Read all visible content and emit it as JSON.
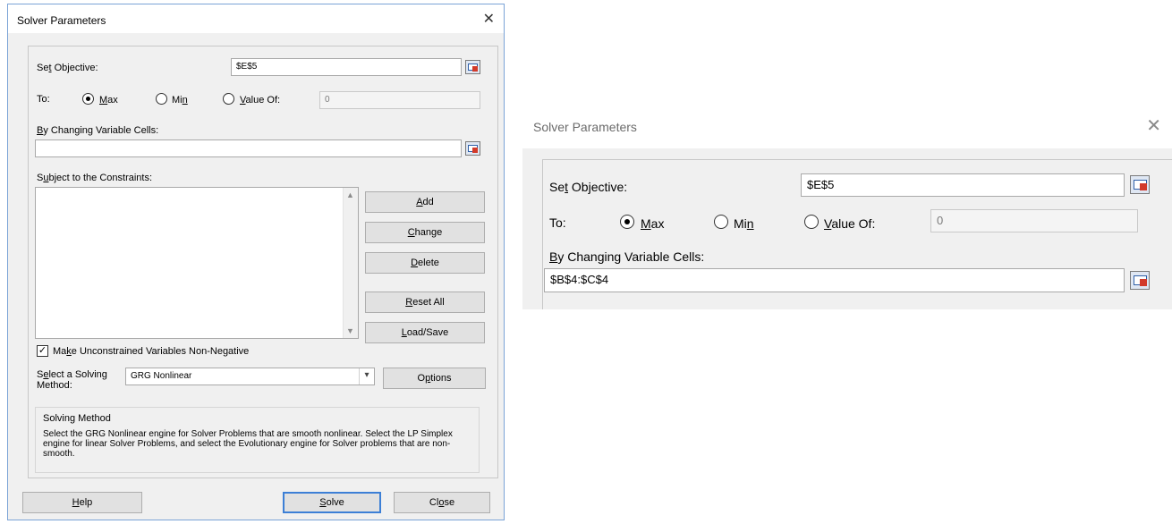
{
  "dialog1": {
    "title": "Solver Parameters",
    "close_icon": "✕",
    "set_objective": {
      "label": "Set Objective:",
      "value": "$E$5"
    },
    "to": {
      "label": "To:",
      "max": "Max",
      "min": "Min",
      "value_of": "Value Of:",
      "value_of_value": "0",
      "selected": "max"
    },
    "changing_cells": {
      "label": "By Changing Variable Cells:",
      "value": ""
    },
    "constraints": {
      "label": "Subject to the Constraints:",
      "items": []
    },
    "buttons": {
      "add": "Add",
      "change": "Change",
      "delete": "Delete",
      "reset_all": "Reset All",
      "load_save": "Load/Save",
      "options": "Options",
      "help": "Help",
      "solve": "Solve",
      "close": "Close"
    },
    "non_negative": {
      "label": "Make Unconstrained Variables Non-Negative",
      "checked": true
    },
    "method": {
      "label": "Select a Solving Method:",
      "selected": "GRG Nonlinear"
    },
    "solving_method": {
      "title": "Solving Method",
      "text": "Select the GRG Nonlinear engine for Solver Problems that are smooth nonlinear. Select the LP Simplex engine for linear Solver Problems, and select the Evolutionary engine for Solver problems that are non-smooth."
    }
  },
  "dialog2": {
    "title": "Solver Parameters",
    "close_icon": "✕",
    "set_objective": {
      "label": "Set Objective:",
      "value": "$E$5"
    },
    "to": {
      "label": "To:",
      "max": "Max",
      "min": "Min",
      "value_of": "Value Of:",
      "value_of_value": "0",
      "selected": "max"
    },
    "changing_cells": {
      "label": "By Changing Variable Cells:",
      "value": "$B$4:$C$4"
    }
  },
  "colors": {
    "dialog_bg": "#f0f0f0",
    "default_button_border": "#3c7fd6",
    "window_border": "#7aa3d6"
  }
}
